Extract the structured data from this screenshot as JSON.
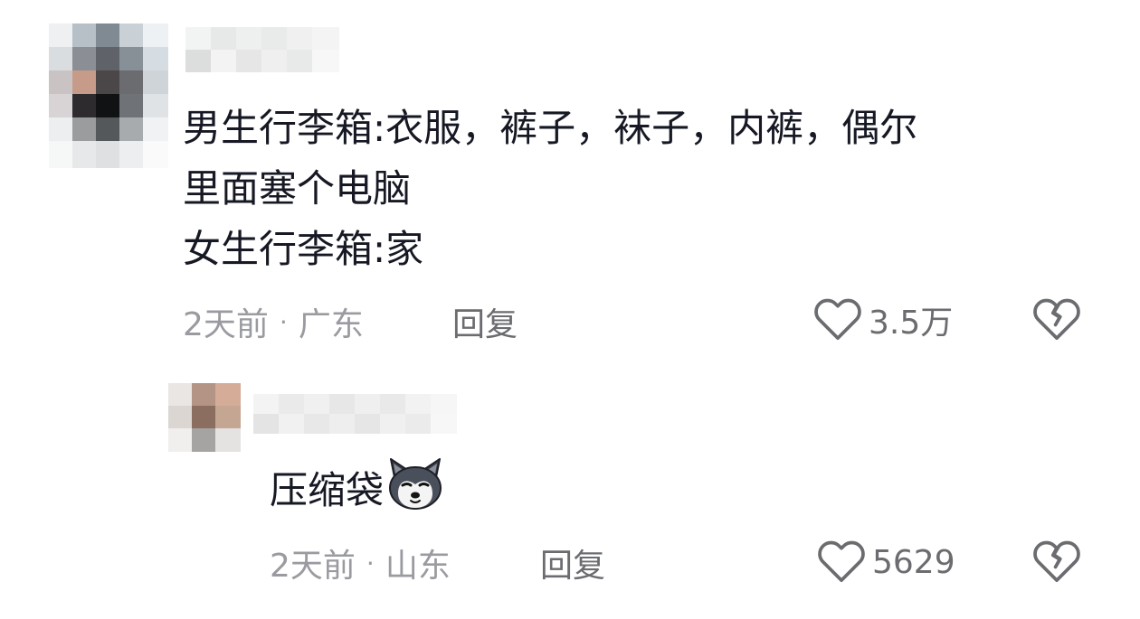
{
  "comments": [
    {
      "text_lines": [
        "男生行李箱:衣服，裤子，袜子，内裤，偶尔",
        "里面塞个电脑",
        "女生行李箱:家"
      ],
      "time": "2天前",
      "separator": "·",
      "location": "广东",
      "reply_label": "回复",
      "like_count": "3.5万"
    }
  ],
  "replies": [
    {
      "text": "压缩袋",
      "emoji": "husky-dog-emoji",
      "time": "2天前",
      "separator": "·",
      "location": "山东",
      "reply_label": "回复",
      "like_count": "5629"
    }
  ],
  "icons": {
    "like": "heart-outline-icon",
    "dislike": "broken-heart-icon"
  },
  "colors": {
    "text": "#161823",
    "meta": "#9a9ba0",
    "action": "#6b6c70"
  }
}
